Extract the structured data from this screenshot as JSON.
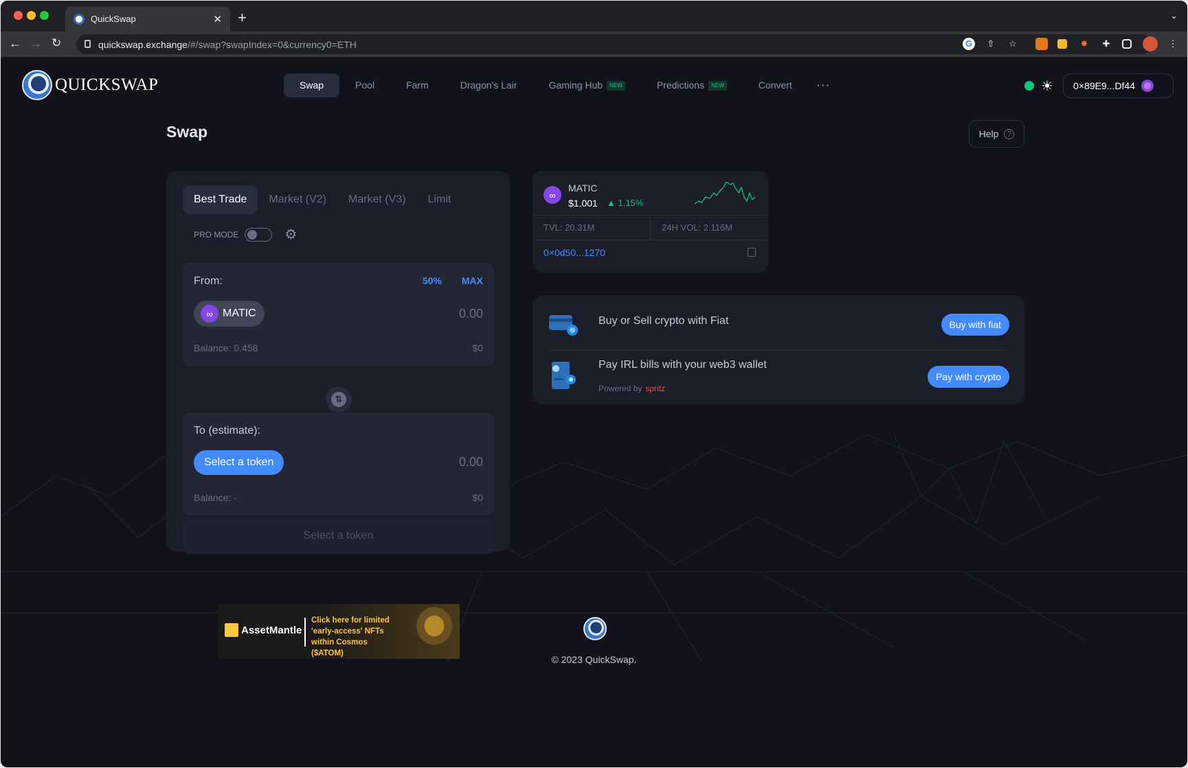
{
  "browser": {
    "tab_title": "QuickSwap",
    "url_domain": "quickswap.exchange",
    "url_path": "/#/swap?swapIndex=0&currency0=ETH"
  },
  "header": {
    "logo_text": "QUICKSWAP",
    "nav": [
      {
        "label": "Swap",
        "active": true
      },
      {
        "label": "Pool"
      },
      {
        "label": "Farm"
      },
      {
        "label": "Dragon's Lair"
      },
      {
        "label": "Gaming Hub",
        "badge": "NEW"
      },
      {
        "label": "Predictions",
        "badge": "NEW"
      },
      {
        "label": "Convert"
      }
    ],
    "more": "···",
    "wallet_address": "0×89E9...Df44"
  },
  "page": {
    "title": "Swap",
    "help_label": "Help"
  },
  "swap": {
    "tabs": [
      "Best Trade",
      "Market (V2)",
      "Market (V3)",
      "Limit"
    ],
    "pro_mode_label": "PRO MODE",
    "from": {
      "label": "From:",
      "pct50": "50%",
      "max": "MAX",
      "token": "MATIC",
      "amount": "0.00",
      "balance": "Balance: 0.458",
      "usd": "$0"
    },
    "to": {
      "label": "To (estimate):",
      "select_label": "Select a token",
      "amount": "0.00",
      "balance": "Balance: -",
      "usd": "$0"
    },
    "submit_label": "Select a token"
  },
  "ad": {
    "brand": "AssetMantle",
    "line1": "Click here for limited",
    "line2": "'early-access' NFTs",
    "line3": "within Cosmos ($ATOM)"
  },
  "token_info": {
    "symbol": "MATIC",
    "price": "$1.001",
    "change": "1.15%",
    "tvl": "TVL: 20.31M",
    "vol": "24H VOL: 2.116M",
    "address": "0×0d50...1270"
  },
  "fiat": {
    "row1_text": "Buy or Sell crypto with Fiat",
    "row1_button": "Buy with fiat",
    "row2_text": "Pay IRL bills with your web3 wallet",
    "powered_by": "Powered by",
    "powered_brand": "spritz",
    "row2_button": "Pay with crypto"
  },
  "footer": {
    "copyright": "© 2023 QuickSwap."
  },
  "colors": {
    "accent": "#448aff",
    "positive": "#0fc679",
    "matic": "#8247e5",
    "background": "#12131a",
    "card": "#1b1e29"
  }
}
